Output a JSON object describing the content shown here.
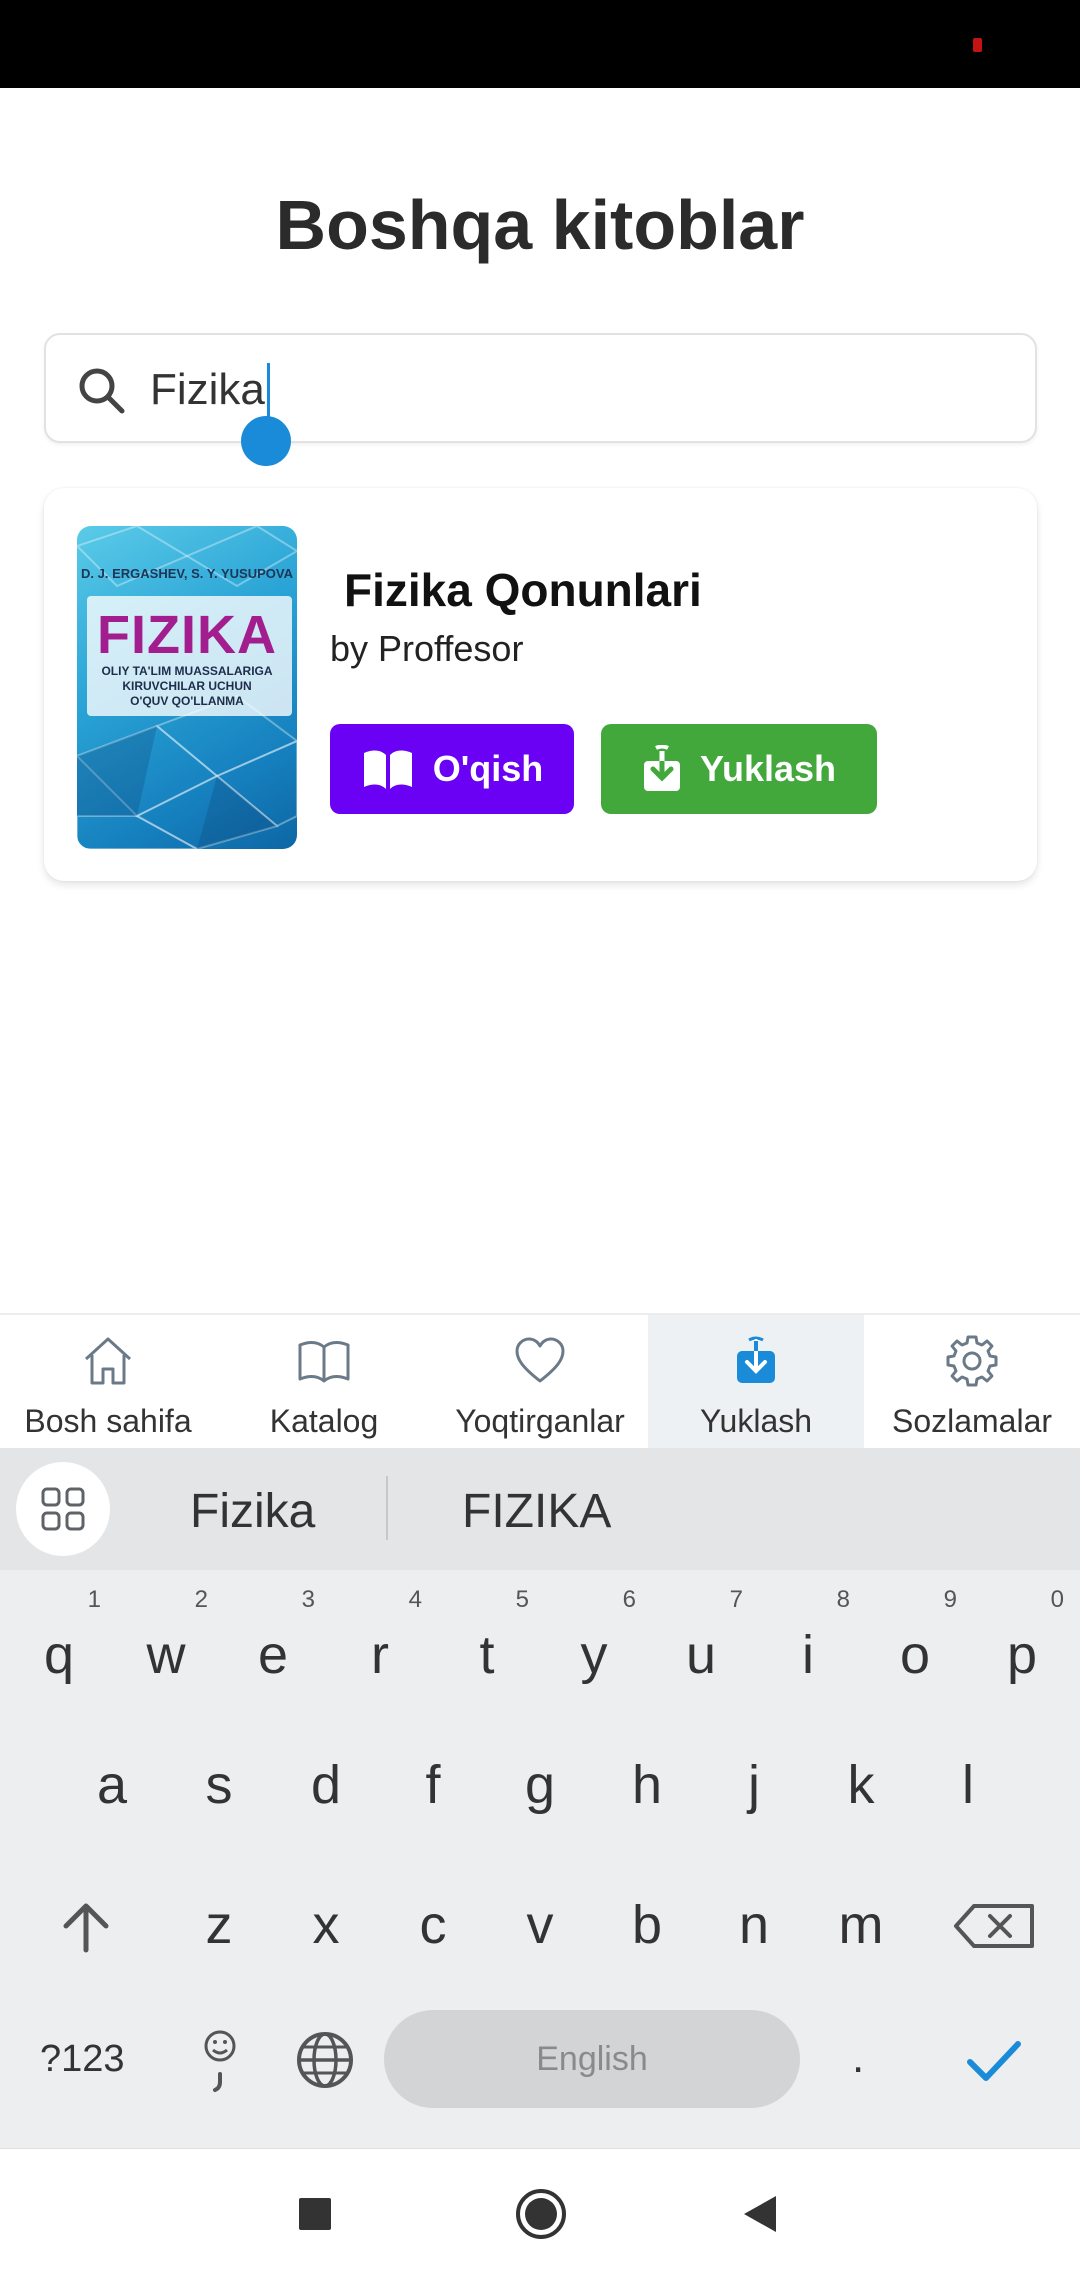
{
  "page": {
    "title": "Boshqa kitoblar"
  },
  "search": {
    "value": "Fizika"
  },
  "book": {
    "title": "Fizika Qonunlari",
    "author": "by Proffesor",
    "cover": {
      "authors": "D. J. ERGASHEV, S. Y. YUSUPOVA",
      "title": "FIZIKA",
      "subtitle_lines": [
        "OLIY TA'LIM MUASSALARIGA",
        "KIRUVCHILAR UCHUN",
        "O'QUV QO'LLANMA"
      ]
    },
    "read_label": "O'qish",
    "download_label": "Yuklash",
    "read_color": "#6a00f4",
    "download_color": "#43a83c"
  },
  "bottom_nav": {
    "items": [
      {
        "label": "Bosh sahifa",
        "icon": "home-icon"
      },
      {
        "label": "Katalog",
        "icon": "book-open-icon"
      },
      {
        "label": "Yoqtirganlar",
        "icon": "heart-icon"
      },
      {
        "label": "Yuklash",
        "icon": "download-icon",
        "active": true
      },
      {
        "label": "Sozlamalar",
        "icon": "gear-icon"
      }
    ],
    "active_color": "#1a8bd8"
  },
  "keyboard": {
    "suggestions": [
      "Fizika",
      "FIZIKA"
    ],
    "row1": [
      {
        "k": "q",
        "h": "1"
      },
      {
        "k": "w",
        "h": "2"
      },
      {
        "k": "e",
        "h": "3"
      },
      {
        "k": "r",
        "h": "4"
      },
      {
        "k": "t",
        "h": "5"
      },
      {
        "k": "y",
        "h": "6"
      },
      {
        "k": "u",
        "h": "7"
      },
      {
        "k": "i",
        "h": "8"
      },
      {
        "k": "o",
        "h": "9"
      },
      {
        "k": "p",
        "h": "0"
      }
    ],
    "row2": [
      "a",
      "s",
      "d",
      "f",
      "g",
      "h",
      "j",
      "k",
      "l"
    ],
    "row3": [
      "z",
      "x",
      "c",
      "v",
      "b",
      "n",
      "m"
    ],
    "symbols_label": "?123",
    "space_label": "English",
    "period_label": "."
  }
}
